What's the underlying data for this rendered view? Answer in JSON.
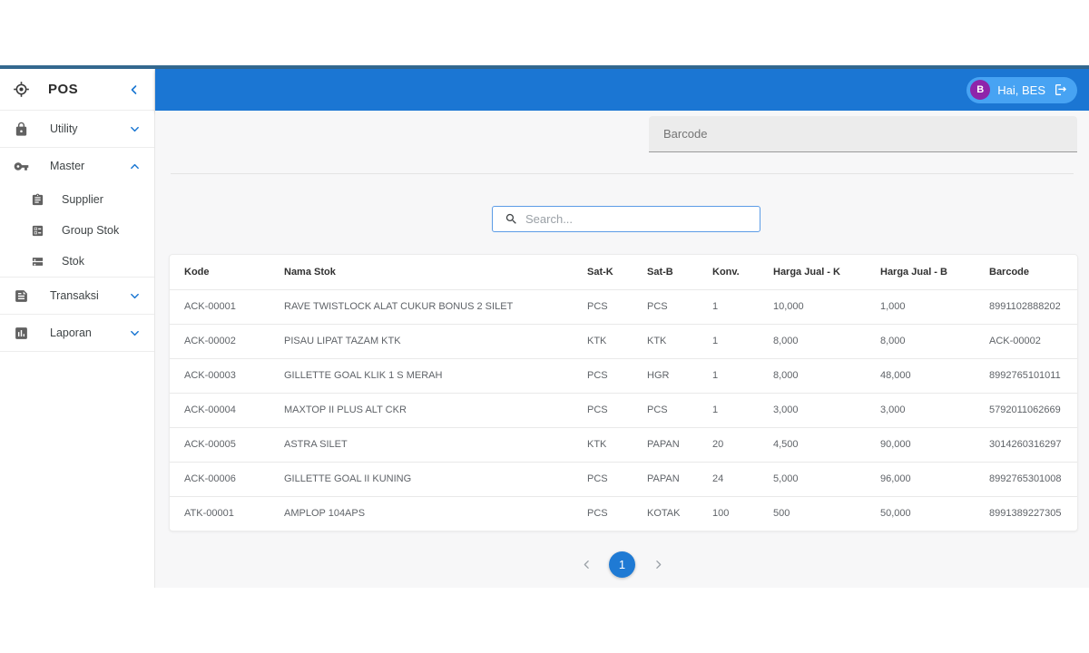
{
  "brand": {
    "title": "POS"
  },
  "sidebar": {
    "items": [
      {
        "icon": "lock-icon",
        "label": "Utility",
        "chevron": "down",
        "sub": false,
        "divider_after": true
      },
      {
        "icon": "key-icon",
        "label": "Master",
        "chevron": "up",
        "sub": false,
        "divider_after": false
      },
      {
        "icon": "clipboard-icon",
        "label": "Supplier",
        "chevron": null,
        "sub": true,
        "divider_after": false
      },
      {
        "icon": "ballot-icon",
        "label": "Group Stok",
        "chevron": null,
        "sub": true,
        "divider_after": false
      },
      {
        "icon": "storage-icon",
        "label": "Stok",
        "chevron": null,
        "sub": true,
        "divider_after": true
      },
      {
        "icon": "receipt-icon",
        "label": "Transaksi",
        "chevron": "down",
        "sub": false,
        "divider_after": true
      },
      {
        "icon": "chart-icon",
        "label": "Laporan",
        "chevron": "down",
        "sub": false,
        "divider_after": true
      }
    ]
  },
  "header": {
    "user": {
      "initial": "B",
      "greeting": "Hai, BES"
    }
  },
  "toolbar": {
    "barcode_placeholder": "Barcode"
  },
  "search": {
    "placeholder": "Search..."
  },
  "table": {
    "columns": [
      "Kode",
      "Nama Stok",
      "Sat-K",
      "Sat-B",
      "Konv.",
      "Harga Jual - K",
      "Harga Jual - B",
      "Barcode"
    ],
    "rows": [
      [
        "ACK-00001",
        "RAVE TWISTLOCK ALAT CUKUR BONUS 2 SILET",
        "PCS",
        "PCS",
        "1",
        "10,000",
        "1,000",
        "8991102888202"
      ],
      [
        "ACK-00002",
        "PISAU LIPAT TAZAM KTK",
        "KTK",
        "KTK",
        "1",
        "8,000",
        "8,000",
        "ACK-00002"
      ],
      [
        "ACK-00003",
        "GILLETTE GOAL KLIK 1 S MERAH",
        "PCS",
        "HGR",
        "1",
        "8,000",
        "48,000",
        "8992765101011"
      ],
      [
        "ACK-00004",
        "MAXTOP II PLUS ALT CKR",
        "PCS",
        "PCS",
        "1",
        "3,000",
        "3,000",
        "5792011062669"
      ],
      [
        "ACK-00005",
        "ASTRA SILET",
        "KTK",
        "PAPAN",
        "20",
        "4,500",
        "90,000",
        "3014260316297"
      ],
      [
        "ACK-00006",
        "GILLETTE GOAL II KUNING",
        "PCS",
        "PAPAN",
        "24",
        "5,000",
        "96,000",
        "8992765301008"
      ],
      [
        "ATK-00001",
        "AMPLOP 104APS",
        "PCS",
        "KOTAK",
        "100",
        "500",
        "50,000",
        "8991389227305"
      ]
    ]
  },
  "pagination": {
    "current": "1"
  },
  "colors": {
    "appbar_blue": "#1b76d3",
    "topstrip_blue": "#33688f",
    "accent_blue": "#1f7ad4",
    "badge_blue": "#47a3f3",
    "avatar_purple": "#8e24aa",
    "content_bg": "#f7f7f8"
  }
}
